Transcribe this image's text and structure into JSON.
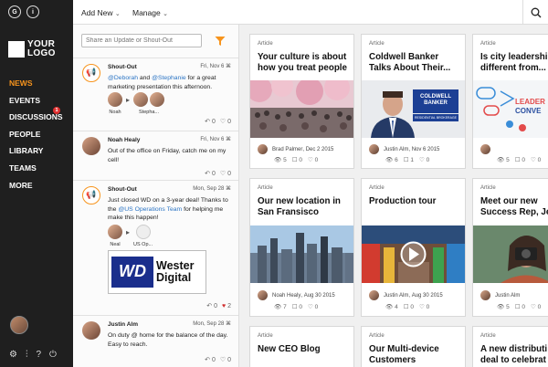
{
  "sidebar": {
    "top_icons": [
      "G",
      "i"
    ],
    "logo": {
      "line1": "YOUR",
      "line2": "LOGO"
    },
    "nav": [
      {
        "label": "NEWS",
        "active": true
      },
      {
        "label": "EVENTS"
      },
      {
        "label": "DISCUSSIONS",
        "badge": "1"
      },
      {
        "label": "PEOPLE"
      },
      {
        "label": "LIBRARY"
      },
      {
        "label": "TEAMS"
      },
      {
        "label": "MORE"
      }
    ],
    "tools": [
      "⚙",
      "⫶",
      "?",
      "⏻"
    ]
  },
  "topbar": {
    "add_new": "Add New",
    "manage": "Manage",
    "chevron": "⌄"
  },
  "feed": {
    "share_placeholder": "Share an Update or Shout-Out",
    "posts": [
      {
        "title": "Shout-Out",
        "date": "Fri, Nov 6",
        "text_parts": [
          "@Deborah",
          " and ",
          "@Stephanie",
          " for a great marketing presentation this afternoon."
        ],
        "mentions": [
          "Noah",
          "Deborah, Stephanie"
        ],
        "mention_label_2": "Stepha...",
        "actions": {
          "reply": "0",
          "like": "0"
        }
      },
      {
        "title": "Noah Healy",
        "date": "Fri, Nov 6",
        "text": "Out of the office on Friday, catch me on my cell!",
        "actions": {
          "reply": "0",
          "like": "0"
        }
      },
      {
        "title": "Shout-Out",
        "date": "Mon, Sep 28",
        "text_parts": [
          "Just closed WD on a 3-year deal! Thanks to the ",
          "@US Operations Team",
          " for helping me make this happen!"
        ],
        "mentions": [
          "Neal",
          "US Op..."
        ],
        "image": {
          "logo": "WD",
          "text_line1": "Wester",
          "text_line2": "Digital"
        },
        "actions": {
          "reply": "0",
          "like": "2"
        }
      },
      {
        "title": "Justin Alm",
        "date": "Mon, Sep 28",
        "text": "On duty @ home for the balance of the day. Easy to reach.",
        "actions": {
          "reply": "0",
          "like": "0"
        }
      }
    ]
  },
  "cards": [
    {
      "type": "Article",
      "title": "Your culture is about you how you treat people",
      "title_display": [
        "Your culture is about",
        "how you treat people"
      ],
      "author": "Brad Palmer",
      "date": "Dec 2 2015",
      "views": "5",
      "comments": "0",
      "likes": "0"
    },
    {
      "type": "Article",
      "title_display": [
        "Coldwell Banker",
        "Talks About Their..."
      ],
      "author": "Justin Alm",
      "date": "Nov 6 2015",
      "views": "6",
      "comments": "1",
      "likes": "0",
      "logo": "COLDWELL BANKER",
      "logo_sub": "RESIDENTIAL BROKERAGE"
    },
    {
      "type": "Article",
      "title_display": [
        "Is city leadership",
        "different from..."
      ],
      "author": "",
      "date": "",
      "views": "5",
      "comments": "0",
      "likes": "0"
    },
    {
      "type": "Article",
      "title_display": [
        "Our new location in",
        "San Fransisco"
      ],
      "author": "Noah Healy",
      "date": "Aug 30 2015",
      "views": "7",
      "comments": "0",
      "likes": "0"
    },
    {
      "type": "Article",
      "title_display": [
        "Production tour"
      ],
      "author": "Justin Alm",
      "date": "Aug 30 2015",
      "views": "4",
      "comments": "0",
      "likes": "0"
    },
    {
      "type": "Article",
      "title_display": [
        "Meet our new",
        "Success Rep, Jen"
      ],
      "author": "Justin Alm",
      "date": "",
      "views": "5",
      "comments": "0",
      "likes": "0"
    },
    {
      "type": "Article",
      "title_display": [
        "New CEO Blog"
      ]
    },
    {
      "type": "Article",
      "title_display": [
        "Our Multi-device",
        "Customers"
      ]
    },
    {
      "type": "Article",
      "title_display": [
        "A new distributi",
        "deal to celebrat"
      ]
    }
  ],
  "colors": {
    "accent": "#f7941d",
    "sidebar": "#1f1f1f",
    "link": "#2b74c4"
  }
}
